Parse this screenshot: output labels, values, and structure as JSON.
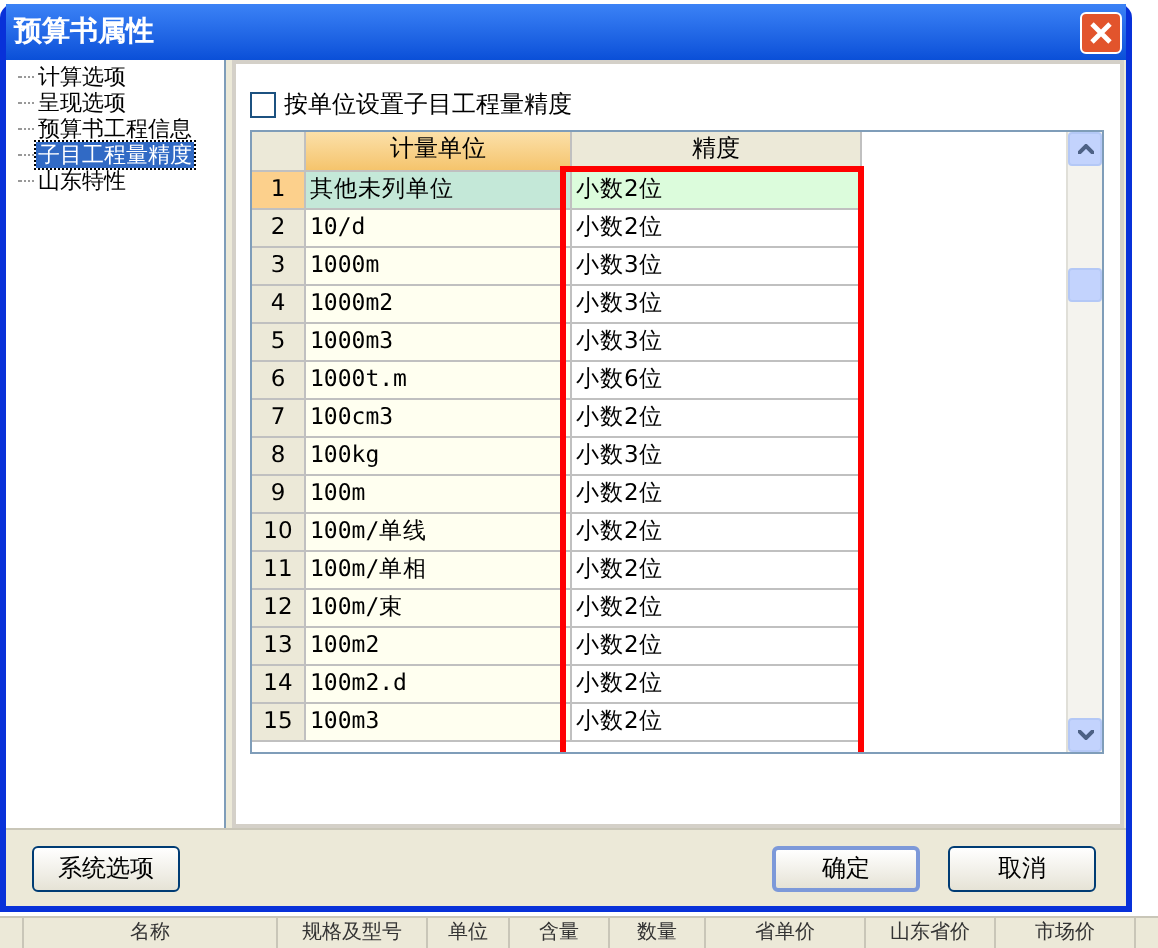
{
  "window": {
    "title": "预算书属性"
  },
  "tree": [
    {
      "label": "计算选项",
      "selected": false
    },
    {
      "label": "呈现选项",
      "selected": false
    },
    {
      "label": "预算书工程信息",
      "selected": false
    },
    {
      "label": "子目工程量精度",
      "selected": true
    },
    {
      "label": "山东特性",
      "selected": false
    }
  ],
  "by_unit": {
    "label": "按单位设置子目工程量精度",
    "checked": false
  },
  "table": {
    "columns": [
      "计量单位",
      "精度"
    ],
    "rows": [
      {
        "num": "1",
        "unit": "其他未列单位",
        "precision": "小数2位",
        "selected": true
      },
      {
        "num": "2",
        "unit": "10/d",
        "precision": "小数2位",
        "selected": false
      },
      {
        "num": "3",
        "unit": "1000m",
        "precision": "小数3位",
        "selected": false
      },
      {
        "num": "4",
        "unit": "1000m2",
        "precision": "小数3位",
        "selected": false
      },
      {
        "num": "5",
        "unit": "1000m3",
        "precision": "小数3位",
        "selected": false
      },
      {
        "num": "6",
        "unit": "1000t.m",
        "precision": "小数6位",
        "selected": false
      },
      {
        "num": "7",
        "unit": "100cm3",
        "precision": "小数2位",
        "selected": false
      },
      {
        "num": "8",
        "unit": "100kg",
        "precision": "小数3位",
        "selected": false
      },
      {
        "num": "9",
        "unit": "100m",
        "precision": "小数2位",
        "selected": false
      },
      {
        "num": "10",
        "unit": "100m/单线",
        "precision": "小数2位",
        "selected": false
      },
      {
        "num": "11",
        "unit": "100m/单相",
        "precision": "小数2位",
        "selected": false
      },
      {
        "num": "12",
        "unit": "100m/束",
        "precision": "小数2位",
        "selected": false
      },
      {
        "num": "13",
        "unit": "100m2",
        "precision": "小数2位",
        "selected": false
      },
      {
        "num": "14",
        "unit": "100m2.d",
        "precision": "小数2位",
        "selected": false
      },
      {
        "num": "15",
        "unit": "100m3",
        "precision": "小数2位",
        "selected": false
      }
    ]
  },
  "buttons": {
    "system": "系统选项",
    "ok": "确定",
    "cancel": "取消"
  },
  "background_columns": [
    "名称",
    "规格及型号",
    "单位",
    "含量",
    "数量",
    "省单价",
    "山东省价",
    "市场价"
  ]
}
